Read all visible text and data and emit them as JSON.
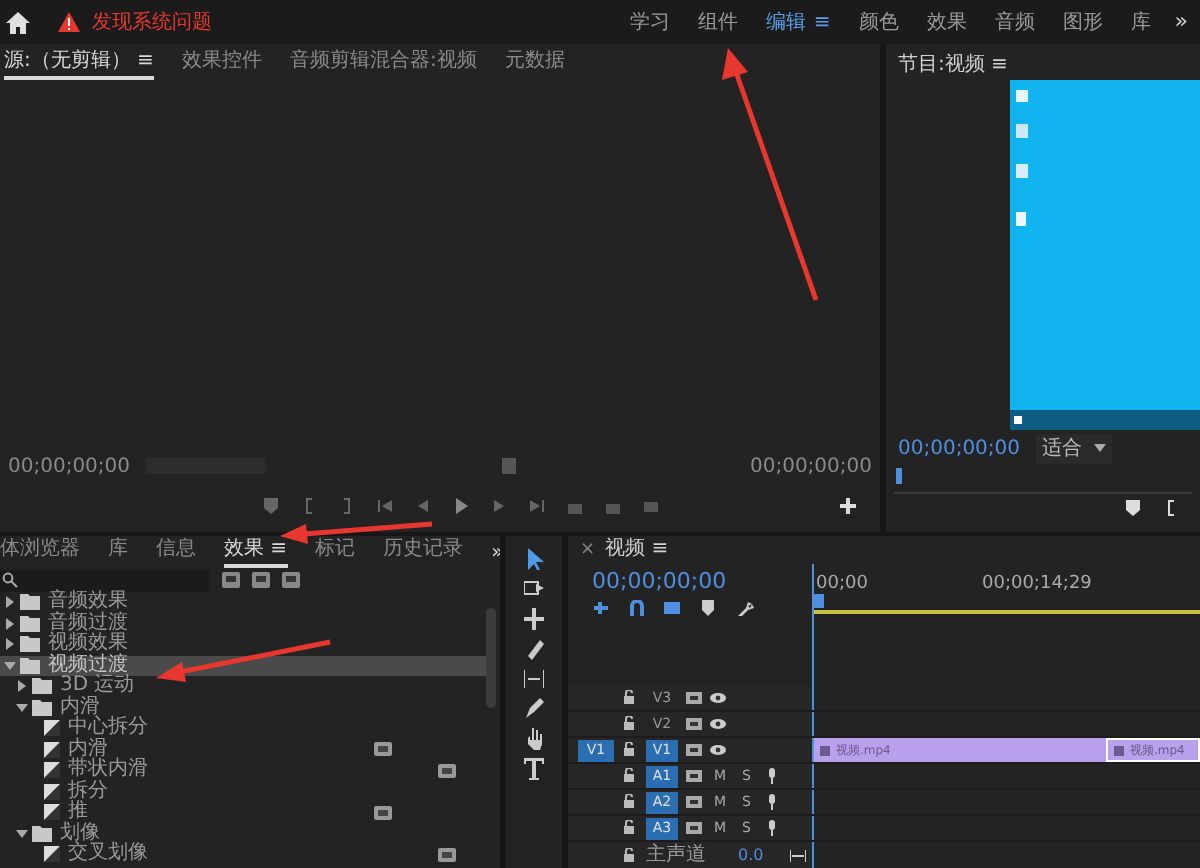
{
  "alert": {
    "text": "发现系统问题"
  },
  "workspaces": [
    {
      "label": "学习",
      "selected": false
    },
    {
      "label": "组件",
      "selected": false
    },
    {
      "label": "编辑",
      "selected": true,
      "menu": "≡"
    },
    {
      "label": "颜色",
      "selected": false
    },
    {
      "label": "效果",
      "selected": false
    },
    {
      "label": "音频",
      "selected": false
    },
    {
      "label": "图形",
      "selected": false
    },
    {
      "label": "库",
      "selected": false
    }
  ],
  "workspace_more": "»",
  "source_panel": {
    "tabs": [
      {
        "label": "源:（无剪辑）",
        "menu": "≡",
        "selected": true
      },
      {
        "label": "效果控件",
        "selected": false
      },
      {
        "label": "音频剪辑混合器:视频",
        "selected": false
      },
      {
        "label": "元数据",
        "selected": false
      }
    ],
    "timecode_left": "00;00;00;00",
    "timecode_right": "00;00;00;00"
  },
  "program_panel": {
    "title": "节目:视频",
    "menu": "≡",
    "timecode": "00;00;00;00",
    "zoom": "适合"
  },
  "project_panel": {
    "tabs": [
      {
        "label": "体浏览器",
        "selected": false
      },
      {
        "label": "库",
        "selected": false
      },
      {
        "label": "信息",
        "selected": false
      },
      {
        "label": "效果",
        "menu": "≡",
        "selected": true
      },
      {
        "label": "标记",
        "selected": false
      },
      {
        "label": "历史记录",
        "selected": false
      }
    ],
    "more": "»",
    "effects": [
      {
        "label": "音频效果",
        "kind": "folder",
        "expanded": false,
        "selected": false
      },
      {
        "label": "音频过渡",
        "kind": "folder",
        "expanded": false,
        "selected": false
      },
      {
        "label": "视频效果",
        "kind": "folder",
        "expanded": false,
        "selected": false
      },
      {
        "label": "视频过渡",
        "kind": "folder",
        "expanded": true,
        "selected": true,
        "children": [
          {
            "label": "3D 运动",
            "kind": "folder",
            "expanded": false,
            "selected": false
          },
          {
            "label": "内滑",
            "kind": "folder",
            "expanded": true,
            "selected": false,
            "children": [
              {
                "label": "中心拆分",
                "kind": "effect",
                "selected": false,
                "badge_a": false,
                "badge_b": false
              },
              {
                "label": "内滑",
                "kind": "effect",
                "selected": false,
                "badge_a": true,
                "badge_b": false
              },
              {
                "label": "带状内滑",
                "kind": "effect",
                "selected": false,
                "badge_a": false,
                "badge_b": true
              },
              {
                "label": "拆分",
                "kind": "effect",
                "selected": false,
                "badge_a": false,
                "badge_b": false
              },
              {
                "label": "推",
                "kind": "effect",
                "selected": false,
                "badge_a": true,
                "badge_b": false
              }
            ]
          },
          {
            "label": "划像",
            "kind": "folder",
            "expanded": true,
            "selected": false,
            "children": [
              {
                "label": "交叉划像",
                "kind": "effect",
                "selected": false,
                "badge_a": false,
                "badge_b": true
              }
            ]
          }
        ]
      }
    ]
  },
  "timeline": {
    "close": "×",
    "title": "视频",
    "menu": "≡",
    "timecode": "00;00;00;00",
    "ruler": [
      "00;00",
      "00;00;14;29"
    ],
    "tracks": [
      {
        "kind": "video",
        "label": "V3",
        "targeted": false
      },
      {
        "kind": "video",
        "label": "V2",
        "targeted": false
      },
      {
        "kind": "video",
        "label": "V1",
        "targeted": true,
        "source": "V1",
        "clips": [
          {
            "label": "视频.mp4",
            "selected": false
          },
          {
            "label": "视频.mp4",
            "selected": true
          }
        ]
      },
      {
        "kind": "audio",
        "label": "A1",
        "targeted": true,
        "mute": "M",
        "solo": "S"
      },
      {
        "kind": "audio",
        "label": "A2",
        "targeted": true,
        "mute": "M",
        "solo": "S"
      },
      {
        "kind": "audio",
        "label": "A3",
        "targeted": true,
        "mute": "M",
        "solo": "S"
      }
    ],
    "master": {
      "label": "主声道",
      "value": "0.0"
    }
  }
}
